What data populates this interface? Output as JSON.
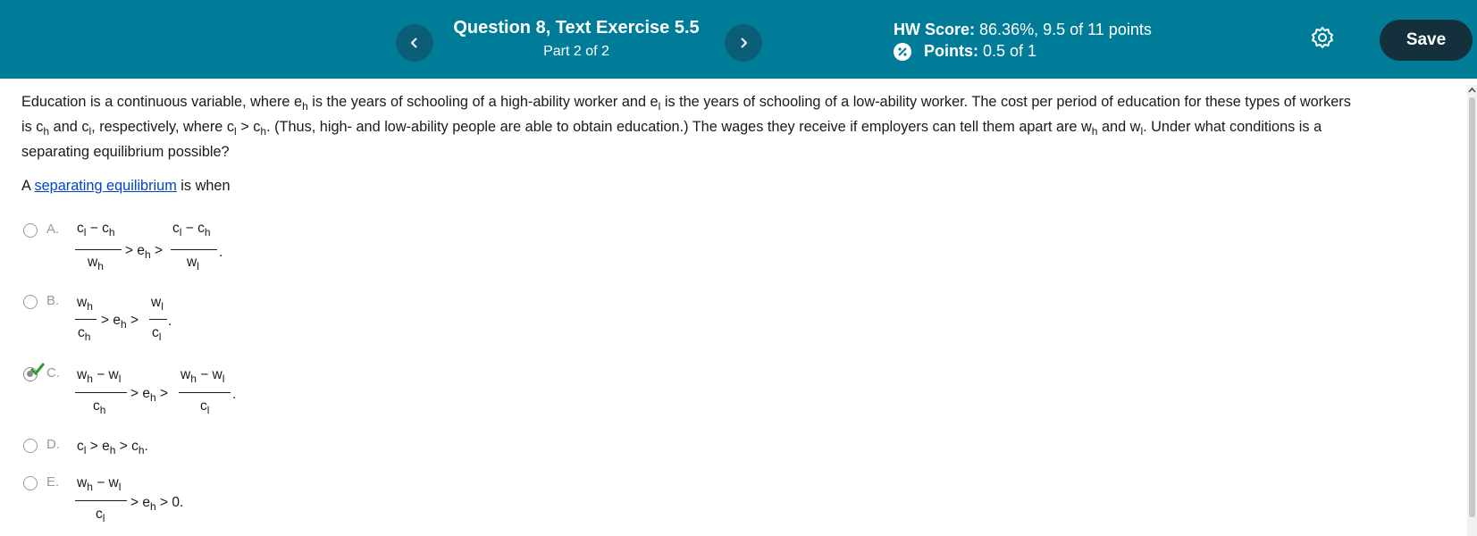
{
  "header": {
    "question_title": "Question 8, Text Exercise 5.5",
    "part": "Part 2 of 2",
    "hw_score_label": "HW Score:",
    "hw_score_value": "86.36%, 9.5 of 11 points",
    "points_label": "Points:",
    "points_value": "0.5 of 1",
    "save_label": "Save"
  },
  "question": {
    "text_1": "Education is a continuous variable, where e",
    "text_2": " is the years of schooling of a high-ability worker and e",
    "text_3": " is the years of schooling of a low-ability worker.  The cost per period of education for these types of workers",
    "text_4": "is c",
    "text_5": " and c",
    "text_6": ", respectively, where c",
    "text_7": " > c",
    "text_8": ".  (Thus, high- and low-ability people are able to obtain education.)  The wages they receive if employers can tell them apart are w",
    "text_9": " and w",
    "text_10": ".  Under what conditions is a",
    "text_11": "separating equilibrium possible?",
    "sub_h": "h",
    "sub_l": "l",
    "lead_prefix": "A ",
    "lead_link": "separating equilibrium",
    "lead_suffix": " is when"
  },
  "options": [
    {
      "letter": "A.",
      "selected": false
    },
    {
      "letter": "B.",
      "selected": false
    },
    {
      "letter": "C.",
      "selected": true,
      "correct": true
    },
    {
      "letter": "D.",
      "selected": false
    },
    {
      "letter": "E.",
      "selected": false
    }
  ],
  "colors": {
    "header_bg": "#007c98",
    "save_bg": "#14303d",
    "link": "#0044cc",
    "check": "#2e9c2e"
  }
}
